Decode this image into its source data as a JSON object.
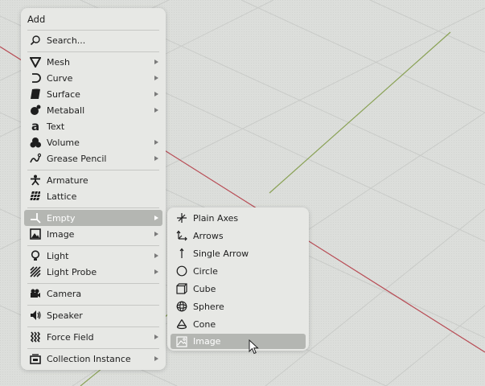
{
  "menu": {
    "title": "Add",
    "search": "Search...",
    "items": [
      {
        "label": "Mesh",
        "icon": "mesh-icon"
      },
      {
        "label": "Curve",
        "icon": "curve-icon"
      },
      {
        "label": "Surface",
        "icon": "surface-icon"
      },
      {
        "label": "Metaball",
        "icon": "metaball-icon"
      },
      {
        "label": "Text",
        "icon": "text-icon"
      },
      {
        "label": "Volume",
        "icon": "volume-icon"
      },
      {
        "label": "Grease Pencil",
        "icon": "grease-pencil-icon"
      },
      {
        "label": "Armature",
        "icon": "armature-icon"
      },
      {
        "label": "Lattice",
        "icon": "lattice-icon"
      },
      {
        "label": "Empty",
        "icon": "empty-icon"
      },
      {
        "label": "Image",
        "icon": "image-icon"
      },
      {
        "label": "Light",
        "icon": "light-icon"
      },
      {
        "label": "Light Probe",
        "icon": "light-probe-icon"
      },
      {
        "label": "Camera",
        "icon": "camera-icon"
      },
      {
        "label": "Speaker",
        "icon": "speaker-icon"
      },
      {
        "label": "Force Field",
        "icon": "force-field-icon"
      },
      {
        "label": "Collection Instance",
        "icon": "collection-instance-icon"
      }
    ]
  },
  "submenu": {
    "items": [
      {
        "label": "Plain Axes",
        "icon": "plain-axes-icon"
      },
      {
        "label": "Arrows",
        "icon": "arrows-icon"
      },
      {
        "label": "Single Arrow",
        "icon": "single-arrow-icon"
      },
      {
        "label": "Circle",
        "icon": "circle-icon"
      },
      {
        "label": "Cube",
        "icon": "cube-icon"
      },
      {
        "label": "Sphere",
        "icon": "sphere-icon"
      },
      {
        "label": "Cone",
        "icon": "cone-icon"
      },
      {
        "label": "Image",
        "icon": "image-icon"
      }
    ]
  },
  "colors": {
    "grid_background": "#dcdedb",
    "menu_background": "#e7e8e5",
    "highlight": "#b4b6b2",
    "x_axis": "#b84c55",
    "y_axis": "#8aa256"
  }
}
